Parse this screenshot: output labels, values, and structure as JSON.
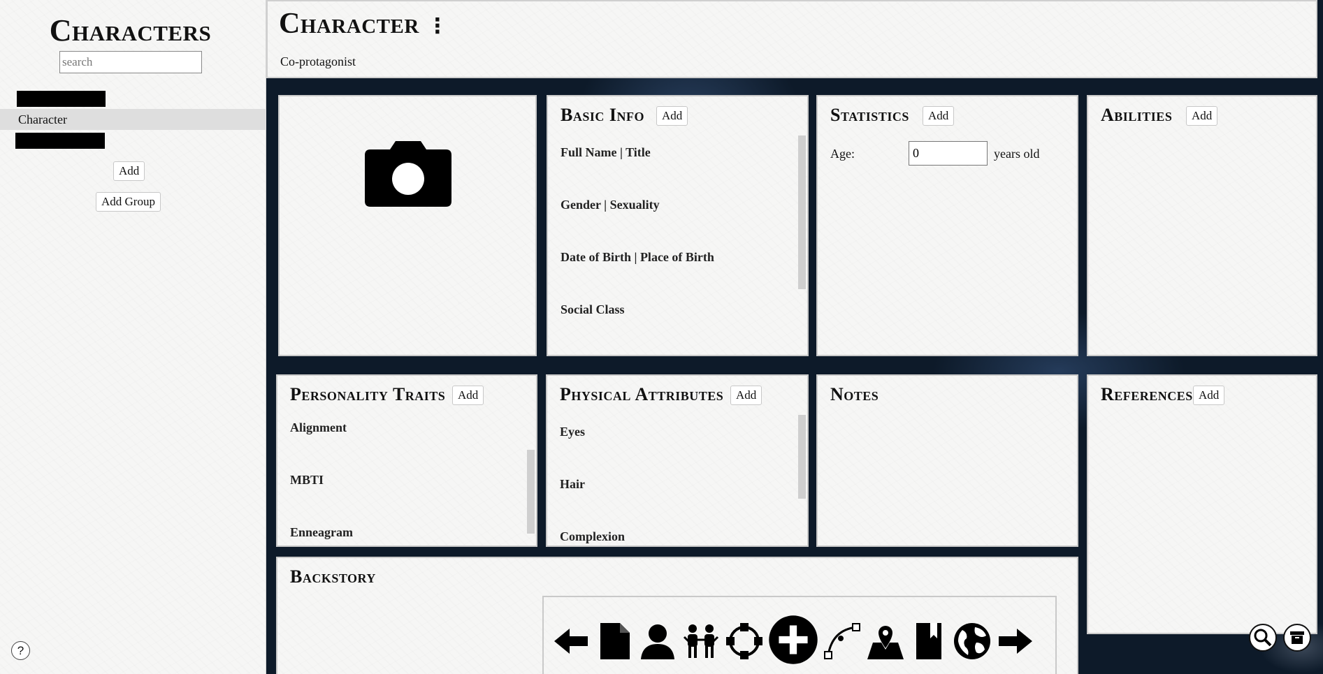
{
  "sidebar": {
    "title": "Characters",
    "search_placeholder": "search",
    "selected_item": "Character",
    "add_label": "Add",
    "add_group_label": "Add Group",
    "help_label": "?"
  },
  "header": {
    "title": "Character",
    "menu_glyph": "⋮",
    "subtitle": "Co-protagonist"
  },
  "panels": {
    "basic_info": {
      "title": "Basic Info",
      "add_label": "Add",
      "fields": [
        "Full Name | Title",
        "Gender | Sexuality",
        "Date of Birth | Place of Birth",
        "Social Class"
      ]
    },
    "statistics": {
      "title": "Statistics",
      "add_label": "Add",
      "age_label": "Age:",
      "age_value": "0",
      "age_suffix": "years old"
    },
    "abilities": {
      "title": "Abilities",
      "add_label": "Add"
    },
    "personality": {
      "title": "Personality Traits",
      "add_label": "Add",
      "fields": [
        "Alignment",
        "MBTI",
        "Enneagram"
      ]
    },
    "physical": {
      "title": "Physical Attributes",
      "add_label": "Add",
      "fields": [
        "Eyes",
        "Hair",
        "Complexion"
      ]
    },
    "notes": {
      "title": "Notes"
    },
    "references": {
      "title": "References",
      "add_label": "Add"
    },
    "backstory": {
      "title": "Backstory"
    }
  },
  "toolbar": {
    "icons": [
      "arrow-left-icon",
      "document-icon",
      "person-icon",
      "people-icon",
      "circle-node-icon",
      "plus-circle-icon",
      "curve-path-icon",
      "map-pin-icon",
      "book-icon",
      "globe-icon",
      "arrow-right-icon"
    ]
  },
  "colors": {
    "accent": "#000000",
    "panel_border": "#c9c9c9",
    "space_bg": "#0d1a29"
  }
}
